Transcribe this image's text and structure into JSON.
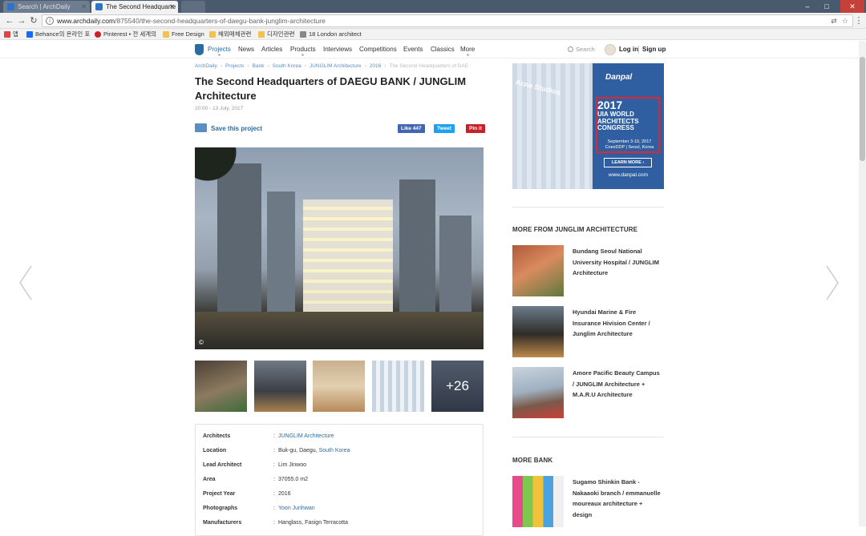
{
  "browser": {
    "tabs": [
      {
        "title": "Search | ArchDaily",
        "active": false
      },
      {
        "title": "The Second Headquarte",
        "active": true
      }
    ],
    "url_host": "www.archdaily.com",
    "url_path": "/875540/the-second-headquarters-of-daegu-bank-junglim-architecture",
    "bookmarks": [
      "앱",
      "Behance의 온라인 포",
      "Pinterest • 전 세계의",
      "Free Design",
      "해외매체관련",
      "디자인관련",
      "18 London architect"
    ]
  },
  "site_nav": {
    "items": [
      "Projects",
      "News",
      "Articles",
      "Products",
      "Interviews",
      "Competitions",
      "Events",
      "Classics",
      "More"
    ],
    "search_label": "Search",
    "login_label": "Log in",
    "signup_label": "Sign up"
  },
  "breadcrumb": [
    "ArchDaily",
    "Projects",
    "Bank",
    "South Korea",
    "JUNGLIM Architecture",
    "2016",
    "The Second Headquarters of DAE"
  ],
  "article": {
    "title": "The Second Headquarters of DAEGU BANK / JUNGLIM Architecture",
    "date": "20:00 - 13 July, 2017",
    "save_label": "Save this project",
    "share": {
      "like": "Like 447",
      "tweet": "Tweet",
      "pin": "Pin it"
    },
    "hero_copyright": "©",
    "more_photos": "+26"
  },
  "project_info": {
    "separator": ":",
    "rows": [
      {
        "label": "Architects",
        "value": "JUNGLIM Architecture",
        "link": true
      },
      {
        "label": "Location",
        "value": "Buk-gu, Daegu, ",
        "link_suffix": "South Korea"
      },
      {
        "label": "Lead Architect",
        "value": "Lim Jinwoo"
      },
      {
        "label": "Area",
        "value": "37055.0 m2"
      },
      {
        "label": "Project Year",
        "value": "2016"
      },
      {
        "label": "Photographs",
        "value": "Yoon Junhwan",
        "link": true
      },
      {
        "label": "Manufacturers",
        "value": "Hanglass, Fasign Terracotta"
      }
    ]
  },
  "ad": {
    "store_sign": "Acne Studios",
    "brand": "Danpal",
    "year": "2017",
    "headline": "UIA WORLD ARCHITECTS CONGRESS",
    "dates": "September 3-10, 2017 CoexDDP | Seoul, Korea",
    "cta": "LEARN MORE ›",
    "site": "www.danpal.com"
  },
  "sidebar": {
    "more_from_heading": "MORE FROM JUNGLIM ARCHITECTURE",
    "more_from": [
      "Bundang Seoul National University Hospital / JUNGLIM Architecture",
      "Hyundai Marine & Fire Insurance Hivision Center / Junglim Architecture",
      "Amore Pacific Beauty Campus / JUNGLIM Architecture + M.A.R.U Architecture"
    ],
    "more_bank_heading": "MORE BANK",
    "more_bank": [
      "Sugamo Shinkin Bank - Nakaaoki branch / emmanuelle moureaux architecture + design"
    ]
  }
}
